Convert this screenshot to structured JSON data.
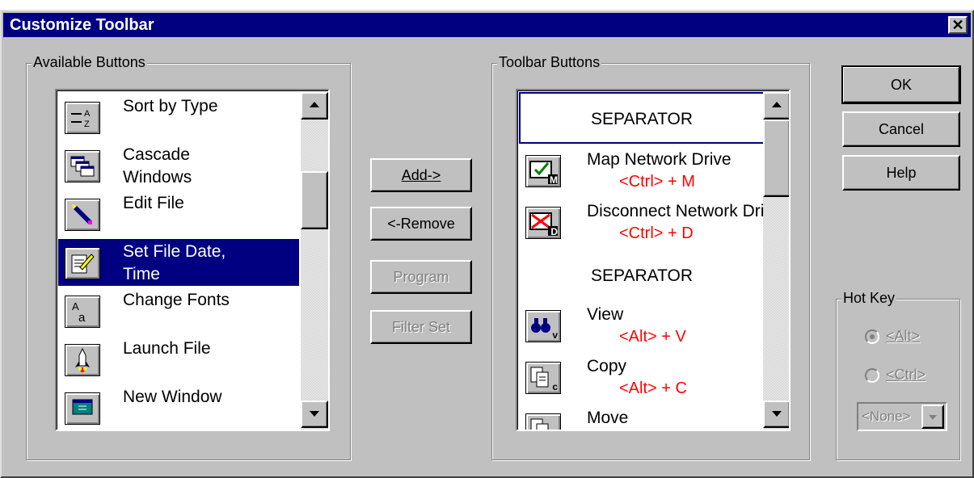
{
  "window": {
    "title": "Customize Toolbar",
    "close_symbol": "✕"
  },
  "available": {
    "label": "Available Buttons",
    "items": [
      {
        "label": "Sort by Type",
        "icon": "sort-by-type-icon",
        "selected": false
      },
      {
        "label": "Cascade\nWindows",
        "icon": "cascade-windows-icon",
        "selected": false
      },
      {
        "label": "Edit File",
        "icon": "edit-file-icon",
        "selected": false
      },
      {
        "label": "Set File Date,\nTime",
        "icon": "set-file-date-icon",
        "selected": true
      },
      {
        "label": "Change Fonts",
        "icon": "change-fonts-icon",
        "selected": false
      },
      {
        "label": "Launch File",
        "icon": "launch-file-icon",
        "selected": false
      },
      {
        "label": "New Window",
        "icon": "new-window-icon",
        "selected": false
      }
    ]
  },
  "actions": {
    "add": "Add->",
    "remove": "<-Remove",
    "program": "Program",
    "filter_set": "Filter Set"
  },
  "toolbar": {
    "label": "Toolbar Buttons",
    "items": [
      {
        "type": "separator",
        "label": "SEPARATOR"
      },
      {
        "type": "button",
        "label": "Map Network Drive",
        "hotkey": "<Ctrl> + M",
        "letter": "M",
        "icon": "map-network-drive-icon"
      },
      {
        "type": "button",
        "label": "Disconnect Network Drive",
        "hotkey": "<Ctrl> + D",
        "letter": "D",
        "icon": "disconnect-network-drive-icon"
      },
      {
        "type": "separator",
        "label": "SEPARATOR"
      },
      {
        "type": "button",
        "label": "View",
        "hotkey": "<Alt> + V",
        "letter": "v",
        "icon": "view-binoculars-icon"
      },
      {
        "type": "button",
        "label": "Copy",
        "hotkey": "<Alt> + C",
        "letter": "c",
        "icon": "copy-icon"
      },
      {
        "type": "button",
        "label": "Move",
        "hotkey": "",
        "letter": "",
        "icon": "move-icon"
      }
    ]
  },
  "dialog_buttons": {
    "ok": "OK",
    "cancel": "Cancel",
    "help": "Help"
  },
  "hotkey": {
    "label": "Hot Key",
    "alt_label": "<Alt>",
    "ctrl_label": "<Ctrl>",
    "selected": "alt",
    "combo_value": "<None>"
  },
  "colors": {
    "title_bg": "#000080",
    "selection": "#000080",
    "hotkey_text": "#ff0000",
    "face": "#c0c0c0"
  }
}
